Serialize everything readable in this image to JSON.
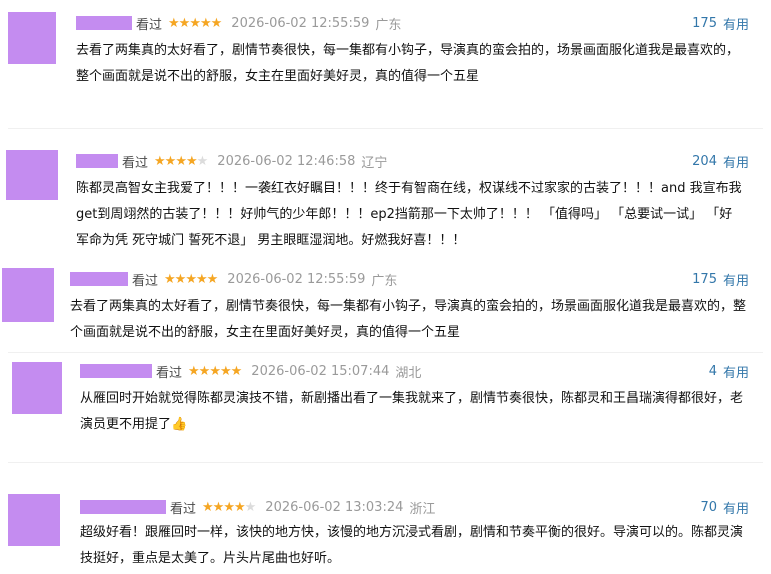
{
  "labels": {
    "watched": "看过",
    "useful": "有用"
  },
  "reviews": [
    {
      "stars": 5,
      "time": "2026-06-02 12:55:59",
      "region": "广东",
      "votes": "175",
      "text": "去看了两集真的太好看了，剧情节奏很快，每一集都有小钩子，导演真的蛮会拍的，场景画面服化道我是最喜欢的，整个画面就是说不出的舒服，女主在里面好美好灵，真的值得一个五星"
    },
    {
      "stars": 4,
      "time": "2026-06-02 12:46:58",
      "region": "辽宁",
      "votes": "204",
      "text": "陈都灵高智女主我爱了！！！一袭红衣好瞩目！！！终于有智商在线，权谋线不过家家的古装了！！！and 我宣布我get到周翊然的古装了！！！好帅气的少年郎！！！ep2挡箭那一下太帅了！！！ 「值得吗」 「总要试一试」 「好 军命为凭 死守城门 誓死不退」 男主眼眶湿润地。好燃我好喜！！！"
    },
    {
      "stars": 5,
      "time": "2026-06-02 12:55:59",
      "region": "广东",
      "votes": "175",
      "text": "去看了两集真的太好看了，剧情节奏很快，每一集都有小钩子，导演真的蛮会拍的，场景画面服化道我是最喜欢的，整个画面就是说不出的舒服，女主在里面好美好灵，真的值得一个五星"
    },
    {
      "stars": 5,
      "time": "2026-06-02 15:07:44",
      "region": "湖北",
      "votes": "4",
      "text": "从雁回时开始就觉得陈都灵演技不错，新剧播出看了一集我就来了，剧情节奏很快，陈都灵和王昌瑞演得都很好，老演员更不用提了",
      "emoji": "👍"
    },
    {
      "stars": 4,
      "time": "2026-06-02 13:03:24",
      "region": "浙江",
      "votes": "70",
      "text": "超级好看！跟雁回时一样，该快的地方快，该慢的地方沉浸式看剧，剧情和节奏平衡的很好。导演可以的。陈都灵演技挺好，重点是太美了。片头片尾曲也好听。"
    }
  ]
}
